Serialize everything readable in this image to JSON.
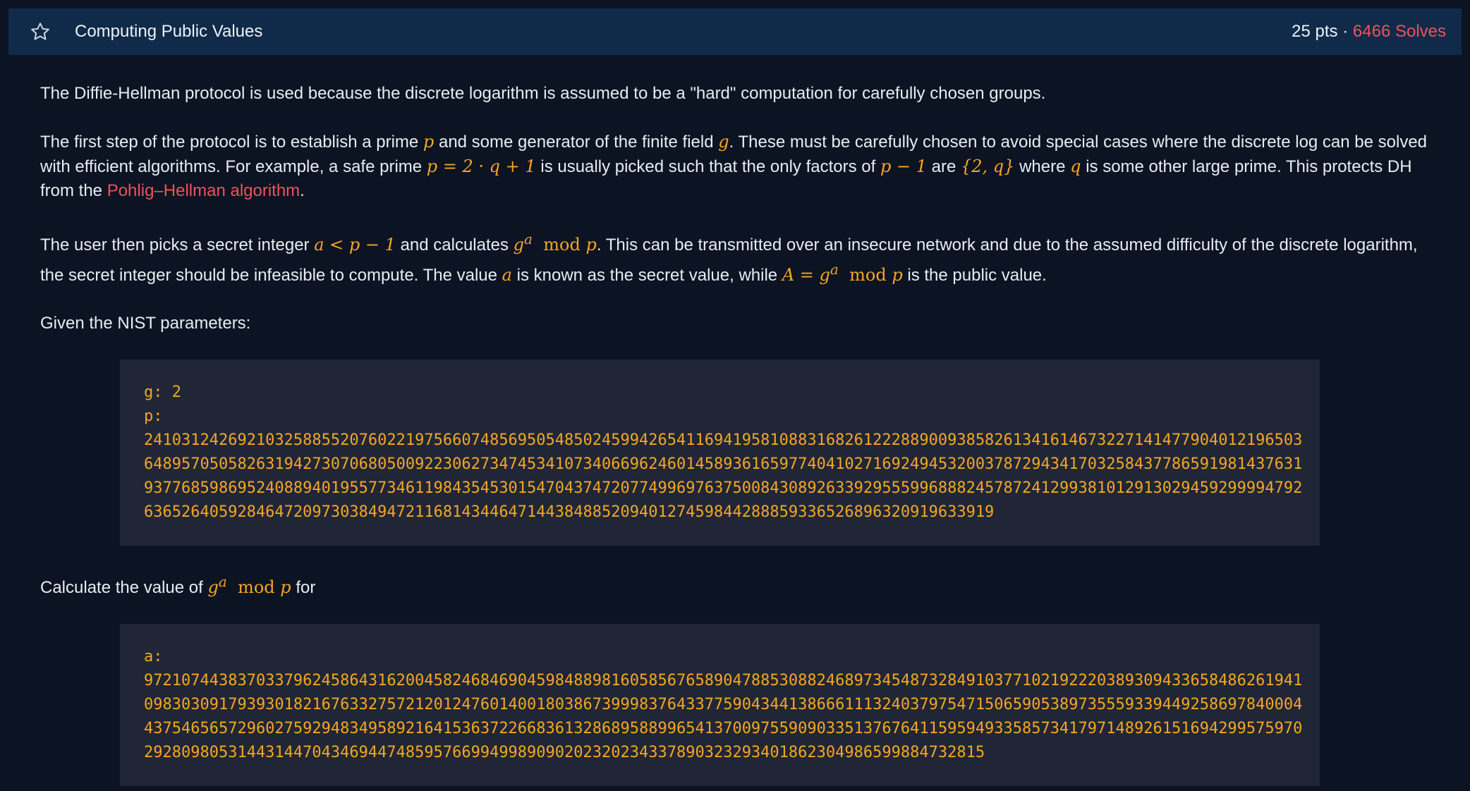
{
  "header": {
    "title": "Computing Public Values",
    "points": "25 pts",
    "separator": "·",
    "solves": "6466 Solves"
  },
  "body": {
    "p1": "The Diffie-Hellman protocol is used because the discrete logarithm is assumed to be a \"hard\" computation for carefully chosen groups.",
    "p2": {
      "t1": "The first step of the protocol is to establish a prime",
      "t2": "and some generator of the finite field",
      "t3": ". These must be carefully chosen to avoid special cases where the discrete log can be solved with efficient algorithms. For example, a safe prime",
      "t4": "is usually picked such that the only factors of",
      "t5": "are",
      "t6": "where",
      "t7": "is some other large prime. This protects DH from the",
      "link": "Pohlig–Hellman algorithm",
      "t8": "."
    },
    "p3": {
      "t1": "The user then picks a secret integer",
      "t2": "and calculates",
      "t3": ". This can be transmitted over an insecure network and due to the assumed difficulty of the discrete logarithm, the secret integer should be infeasible to compute. The value",
      "t4": "is known as the secret value, while",
      "t5": "is the public value."
    },
    "p4": "Given the NIST parameters:",
    "params_code": {
      "g_line": "g: 2",
      "p_label": "p:",
      "p_lines": [
        "2410312426921032588552076022197566074856950548502459942654116941958108831682612228890093858261341614673227141477904012196503",
        "6489570505826319427307068050092230627347453410734066962460145893616597740410271692494532003787294341703258437786591981437631",
        "9377685986952408894019557734611984354530154704374720774996976375008430892633929555996888245787241299381012913029459299994792",
        "636526405928464720973038494721168143446471443848852094012745984428885933652689632091963391​9"
      ]
    },
    "p5": {
      "t1": "Calculate the value of",
      "t2": "for"
    },
    "a_code": {
      "a_label": "a:",
      "a_lines": [
        "9721074438370337962458643162004582468469045984889816058567658904788530882468973454873284910377102192220389309433658486261941",
        "0983030917939301821676332757212012476014001803867399983764337759043441386661113240379754715065905389735559339449258697840004",
        "4375465657296027592948349589216415363722668361328689588996541370097559090335137676411595949335857341797148926151694299575970",
        "292809805314431447043469447485957669949989090202320234337890323293401862304986599884732815"
      ]
    },
    "math": {
      "p": "p",
      "g": "g",
      "safe_prime_eq": "p = 2 · q + 1",
      "p_minus_1": "p − 1",
      "factors_set": "{2, q}",
      "q": "q",
      "a_lt": "a < p − 1",
      "a": "a",
      "A_eq": "A =",
      "g_base": "g",
      "exp_a": "a",
      "mod": "mod",
      "mod_p": "p"
    }
  },
  "colors": {
    "background": "#0c1322",
    "header_bg": "#102a49",
    "code_bg": "#202636",
    "accent_orange": "#f4a623",
    "accent_red": "#f0515d"
  },
  "icons": {
    "favorite": "star-outline-icon"
  }
}
